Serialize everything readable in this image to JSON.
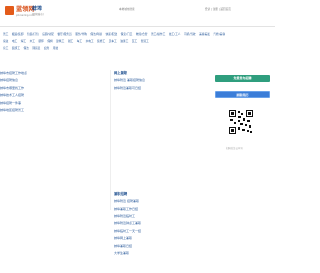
{
  "header": {
    "logo_text": "蓝领网",
    "logo_sub": "job.lanling.com",
    "city": "蚌埠",
    "city_sub": "[切换城市]",
    "search_link": "本地城市搜索",
    "right_links": "登录 | 注册 | 返回首页"
  },
  "categories": {
    "rows": [
      [
        "普工",
        "搬运/装卸",
        "包装/打包",
        "后厨/切配",
        "餐厅/服务员",
        "服务/导购",
        "保洁/阿姨",
        "快递/配送",
        "保安/门卫",
        "物流/仓管",
        "普工/操作工",
        "技工/工人",
        "司机/驾驶",
        "美容美发",
        "汽修/美容"
      ],
      [
        "家政",
        "电工",
        "焊工",
        "木工",
        "厨师",
        "保姆",
        "建筑工",
        "钳工",
        "车工",
        "水电工",
        "装修工",
        "叉车工",
        "油漆工",
        "瓦工",
        "管道工"
      ],
      [
        "杂工",
        "装卸工",
        "保洁",
        "理货员",
        "迎宾",
        "月嫂"
      ]
    ]
  },
  "left": {
    "title": "",
    "items": [
      "蚌埠市招聘工作地点",
      "蚌埠招聘信息",
      "蚌埠市哪里找工作",
      "蚌埠技术工人招聘",
      "蚌埠招聘一件事",
      "蚌埠地区招聘普工"
    ]
  },
  "middle": {
    "title": "网上兼职",
    "items": [
      "蚌埠附近 兼职招聘信息",
      "蚌埠附近兼职可日结"
    ]
  },
  "middle2": {
    "title": "兼职招聘",
    "items": [
      "蚌埠附近 招聘兼职",
      "蚌埠兼职工作日结",
      "蚌埠附近临时工",
      "蚌埠附近钟点工兼职",
      "蚌埠临时工一天一结",
      "蚌埠网上兼职",
      "蚌埠兼职日结",
      "大学生兼职"
    ]
  },
  "right": {
    "btn_publish": "免费发布招聘",
    "btn_resume": "刷新简历",
    "qr_caption": "扫码关注公众号"
  },
  "colors": {
    "accent": "#d8511b",
    "link": "#2a5a9a",
    "green": "#2f9e7e",
    "blue": "#3b7dd8"
  }
}
